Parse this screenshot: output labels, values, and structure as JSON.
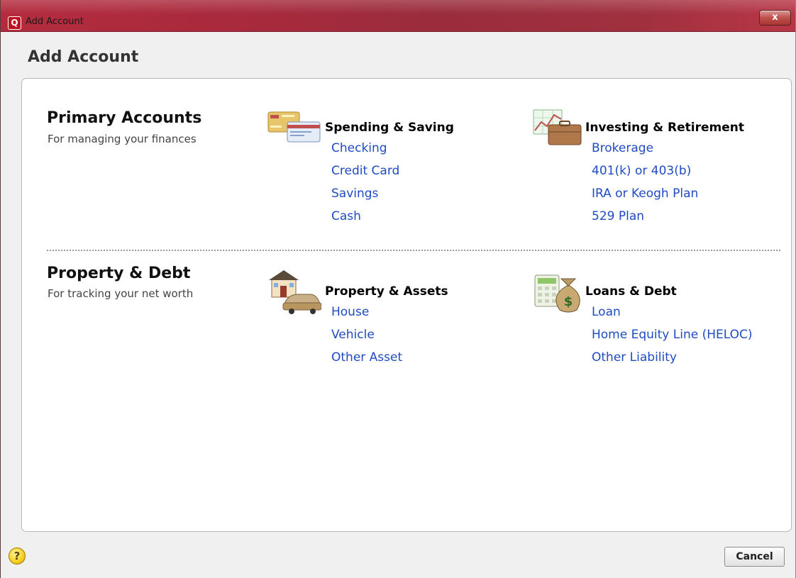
{
  "window": {
    "title": "Add Account",
    "app_icon_letter": "Q",
    "close_glyph": "x"
  },
  "dialog": {
    "heading": "Add Account"
  },
  "sections": {
    "primary": {
      "title": "Primary Accounts",
      "subtitle": "For managing your finances",
      "groups": {
        "spending": {
          "title": "Spending & Saving",
          "icon": "credit-cards-icon",
          "links": [
            "Checking",
            "Credit Card",
            "Savings",
            "Cash"
          ]
        },
        "investing": {
          "title": "Investing & Retirement",
          "icon": "portfolio-chart-icon",
          "links": [
            "Brokerage",
            "401(k) or 403(b)",
            "IRA or Keogh Plan",
            "529 Plan"
          ]
        }
      }
    },
    "property": {
      "title": "Property & Debt",
      "subtitle": "For tracking your net worth",
      "groups": {
        "assets": {
          "title": "Property & Assets",
          "icon": "house-car-icon",
          "links": [
            "House",
            "Vehicle",
            "Other Asset"
          ]
        },
        "loans": {
          "title": "Loans & Debt",
          "icon": "calculator-moneybag-icon",
          "links": [
            "Loan",
            "Home Equity Line (HELOC)",
            "Other Liability"
          ]
        }
      }
    }
  },
  "footer": {
    "help_glyph": "?",
    "cancel_label": "Cancel"
  },
  "colors": {
    "titlebar": "#a82a3c",
    "link": "#1f4bc4"
  }
}
